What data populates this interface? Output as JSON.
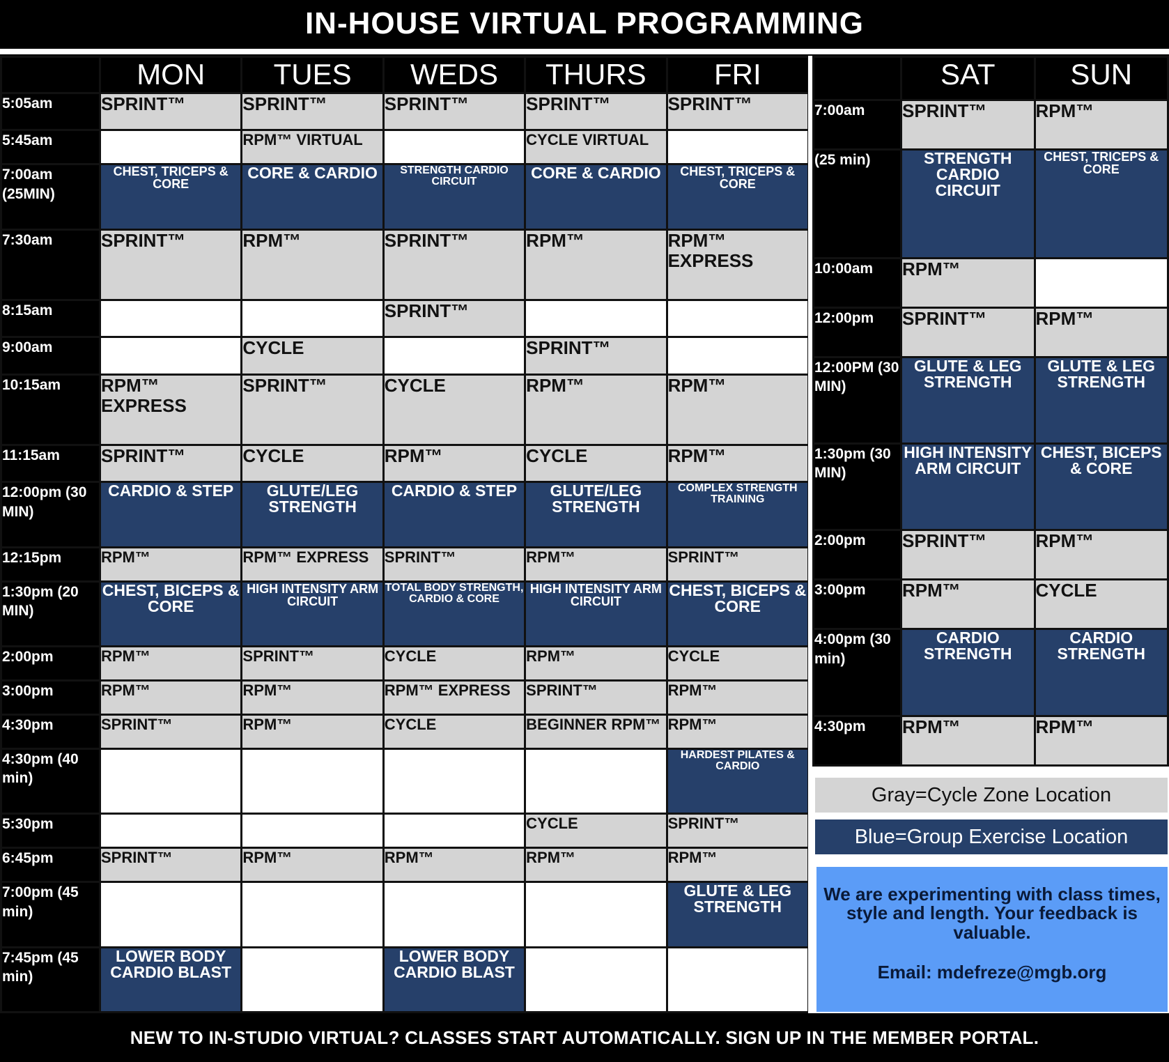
{
  "title": "IN-HOUSE VIRTUAL PROGRAMMING",
  "footer": "NEW TO IN-STUDIO VIRTUAL? CLASSES START AUTOMATICALLY. SIGN UP IN THE MEMBER PORTAL.",
  "colors": {
    "gray": "#d4d4d4",
    "blue": "#26406a",
    "note": "#5b9cf7"
  },
  "weekday": {
    "days": [
      "MON",
      "TUES",
      "WEDS",
      "THURS",
      "FRI"
    ],
    "rows": [
      {
        "time": "5:05am",
        "cells": [
          {
            "t": "SPRINT™",
            "c": "gray"
          },
          {
            "t": "SPRINT™",
            "c": "gray"
          },
          {
            "t": "SPRINT™",
            "c": "gray"
          },
          {
            "t": "SPRINT™",
            "c": "gray"
          },
          {
            "t": "SPRINT™",
            "c": "gray"
          }
        ]
      },
      {
        "time": "5:45am",
        "cells": [
          {
            "t": "",
            "c": "white"
          },
          {
            "t": "RPM™ VIRTUAL",
            "c": "gray sm"
          },
          {
            "t": "",
            "c": "white"
          },
          {
            "t": "CYCLE VIRTUAL",
            "c": "gray sm"
          },
          {
            "t": "",
            "c": "white"
          }
        ]
      },
      {
        "time": "7:00am (25MIN)",
        "cells": [
          {
            "t": "CHEST, TRICEPS & CORE",
            "c": "blue sm"
          },
          {
            "t": "CORE & CARDIO",
            "c": "blue"
          },
          {
            "t": "STRENGTH CARDIO CIRCUIT",
            "c": "blue xs"
          },
          {
            "t": "CORE & CARDIO",
            "c": "blue"
          },
          {
            "t": "CHEST, TRICEPS & CORE",
            "c": "blue sm"
          }
        ]
      },
      {
        "time": "7:30am",
        "cells": [
          {
            "t": "SPRINT™",
            "c": "gray"
          },
          {
            "t": "RPM™",
            "c": "gray"
          },
          {
            "t": "SPRINT™",
            "c": "gray"
          },
          {
            "t": "RPM™",
            "c": "gray"
          },
          {
            "t": "RPM™ EXPRESS",
            "c": "gray"
          }
        ]
      },
      {
        "time": "8:15am",
        "cells": [
          {
            "t": "",
            "c": "white"
          },
          {
            "t": "",
            "c": "white"
          },
          {
            "t": "SPRINT™",
            "c": "gray"
          },
          {
            "t": "",
            "c": "white"
          },
          {
            "t": "",
            "c": "white"
          }
        ]
      },
      {
        "time": "9:00am",
        "cells": [
          {
            "t": "",
            "c": "white"
          },
          {
            "t": "CYCLE",
            "c": "gray"
          },
          {
            "t": "",
            "c": "white"
          },
          {
            "t": "SPRINT™",
            "c": "gray"
          },
          {
            "t": "",
            "c": "white"
          }
        ]
      },
      {
        "time": "10:15am",
        "cells": [
          {
            "t": "RPM™ EXPRESS",
            "c": "gray"
          },
          {
            "t": "SPRINT™",
            "c": "gray"
          },
          {
            "t": "CYCLE",
            "c": "gray"
          },
          {
            "t": "RPM™",
            "c": "gray"
          },
          {
            "t": "RPM™",
            "c": "gray"
          }
        ]
      },
      {
        "time": "11:15am",
        "cells": [
          {
            "t": "SPRINT™",
            "c": "gray"
          },
          {
            "t": "CYCLE",
            "c": "gray"
          },
          {
            "t": "RPM™",
            "c": "gray"
          },
          {
            "t": "CYCLE",
            "c": "gray"
          },
          {
            "t": "RPM™",
            "c": "gray"
          }
        ]
      },
      {
        "time": "12:00pm (30 MIN)",
        "cells": [
          {
            "t": "CARDIO & STEP",
            "c": "blue"
          },
          {
            "t": "GLUTE/LEG STRENGTH",
            "c": "blue"
          },
          {
            "t": "CARDIO & STEP",
            "c": "blue"
          },
          {
            "t": "GLUTE/LEG STRENGTH",
            "c": "blue"
          },
          {
            "t": "COMPLEX STRENGTH TRAINING",
            "c": "blue xs"
          }
        ]
      },
      {
        "time": "12:15pm",
        "cells": [
          {
            "t": "RPM™",
            "c": "gray sm"
          },
          {
            "t": "RPM™ EXPRESS",
            "c": "gray sm"
          },
          {
            "t": "SPRINT™",
            "c": "gray sm"
          },
          {
            "t": "RPM™",
            "c": "gray sm"
          },
          {
            "t": "SPRINT™",
            "c": "gray sm"
          }
        ]
      },
      {
        "time": "1:30pm (20 MIN)",
        "cells": [
          {
            "t": "CHEST, BICEPS & CORE",
            "c": "blue"
          },
          {
            "t": "HIGH INTENSITY ARM CIRCUIT",
            "c": "blue sm"
          },
          {
            "t": "TOTAL BODY STRENGTH, CARDIO & CORE",
            "c": "blue xs"
          },
          {
            "t": "HIGH INTENSITY ARM CIRCUIT",
            "c": "blue sm"
          },
          {
            "t": "CHEST, BICEPS & CORE",
            "c": "blue"
          }
        ]
      },
      {
        "time": "2:00pm",
        "cells": [
          {
            "t": "RPM™",
            "c": "gray sm"
          },
          {
            "t": "SPRINT™",
            "c": "gray sm"
          },
          {
            "t": "CYCLE",
            "c": "gray sm"
          },
          {
            "t": "RPM™",
            "c": "gray sm"
          },
          {
            "t": "CYCLE",
            "c": "gray sm"
          }
        ]
      },
      {
        "time": "3:00pm",
        "cells": [
          {
            "t": "RPM™",
            "c": "gray sm"
          },
          {
            "t": "RPM™",
            "c": "gray sm"
          },
          {
            "t": "RPM™ EXPRESS",
            "c": "gray sm"
          },
          {
            "t": "SPRINT™",
            "c": "gray sm"
          },
          {
            "t": "RPM™",
            "c": "gray sm"
          }
        ]
      },
      {
        "time": "4:30pm",
        "cells": [
          {
            "t": "SPRINT™",
            "c": "gray sm"
          },
          {
            "t": "RPM™",
            "c": "gray sm"
          },
          {
            "t": "CYCLE",
            "c": "gray sm"
          },
          {
            "t": "BEGINNER RPM™",
            "c": "gray sm"
          },
          {
            "t": "RPM™",
            "c": "gray sm"
          }
        ]
      },
      {
        "time": "4:30pm (40 min)",
        "cells": [
          {
            "t": "",
            "c": "white"
          },
          {
            "t": "",
            "c": "white"
          },
          {
            "t": "",
            "c": "white"
          },
          {
            "t": "",
            "c": "white"
          },
          {
            "t": "HARDEST PILATES & CARDIO",
            "c": "blue xs"
          }
        ]
      },
      {
        "time": "5:30pm",
        "cells": [
          {
            "t": "",
            "c": "white"
          },
          {
            "t": "",
            "c": "white"
          },
          {
            "t": "",
            "c": "white"
          },
          {
            "t": "CYCLE",
            "c": "gray sm"
          },
          {
            "t": "SPRINT™",
            "c": "gray sm"
          }
        ]
      },
      {
        "time": "6:45pm",
        "cells": [
          {
            "t": "SPRINT™",
            "c": "gray sm"
          },
          {
            "t": "RPM™",
            "c": "gray sm"
          },
          {
            "t": "RPM™",
            "c": "gray sm"
          },
          {
            "t": "RPM™",
            "c": "gray sm"
          },
          {
            "t": "RPM™",
            "c": "gray sm"
          }
        ]
      },
      {
        "time": "7:00pm (45 min)",
        "cells": [
          {
            "t": "",
            "c": "white"
          },
          {
            "t": "",
            "c": "white"
          },
          {
            "t": "",
            "c": "white"
          },
          {
            "t": "",
            "c": "white"
          },
          {
            "t": "GLUTE & LEG STRENGTH",
            "c": "blue"
          }
        ]
      },
      {
        "time": "7:45pm (45 min)",
        "cells": [
          {
            "t": "LOWER BODY CARDIO BLAST",
            "c": "blue"
          },
          {
            "t": "",
            "c": "white"
          },
          {
            "t": "LOWER BODY CARDIO BLAST",
            "c": "blue"
          },
          {
            "t": "",
            "c": "white"
          },
          {
            "t": "",
            "c": "white"
          }
        ]
      }
    ]
  },
  "weekend": {
    "days": [
      "SAT",
      "SUN"
    ],
    "rows": [
      {
        "time": "7:00am",
        "cells": [
          {
            "t": "SPRINT™",
            "c": "gray"
          },
          {
            "t": "RPM™",
            "c": "gray"
          }
        ]
      },
      {
        "time": "(25 min)",
        "cells": [
          {
            "t": "STRENGTH CARDIO CIRCUIT",
            "c": "blue"
          },
          {
            "t": "CHEST, TRICEPS & CORE",
            "c": "blue sm"
          }
        ]
      },
      {
        "time": "10:00am",
        "cells": [
          {
            "t": "RPM™",
            "c": "gray"
          },
          {
            "t": "",
            "c": "white"
          }
        ]
      },
      {
        "time": "12:00pm",
        "cells": [
          {
            "t": "SPRINT™",
            "c": "gray"
          },
          {
            "t": "RPM™",
            "c": "gray"
          }
        ]
      },
      {
        "time": "12:00PM (30 MIN)",
        "cells": [
          {
            "t": "GLUTE & LEG STRENGTH",
            "c": "blue"
          },
          {
            "t": "GLUTE & LEG STRENGTH",
            "c": "blue"
          }
        ]
      },
      {
        "time": "1:30pm (30 MIN)",
        "cells": [
          {
            "t": "HIGH INTENSITY ARM CIRCUIT",
            "c": "blue"
          },
          {
            "t": "CHEST, BICEPS & CORE",
            "c": "blue"
          }
        ]
      },
      {
        "time": "2:00pm",
        "cells": [
          {
            "t": "SPRINT™",
            "c": "gray"
          },
          {
            "t": "RPM™",
            "c": "gray"
          }
        ]
      },
      {
        "time": "3:00pm",
        "cells": [
          {
            "t": "RPM™",
            "c": "gray"
          },
          {
            "t": "CYCLE",
            "c": "gray"
          }
        ]
      },
      {
        "time": "4:00pm (30 min)",
        "cells": [
          {
            "t": "CARDIO STRENGTH",
            "c": "blue"
          },
          {
            "t": "CARDIO STRENGTH",
            "c": "blue"
          }
        ]
      },
      {
        "time": "4:30pm",
        "cells": [
          {
            "t": "RPM™",
            "c": "gray"
          },
          {
            "t": "RPM™",
            "c": "gray"
          }
        ]
      }
    ]
  },
  "legend": {
    "gray": "Gray=Cycle Zone Location",
    "blue": "Blue=Group Exercise Location"
  },
  "note": {
    "message": "We are experimenting with class times, style and length. Your feedback is valuable.",
    "email": "Email: mdefreze@mgb.org"
  }
}
